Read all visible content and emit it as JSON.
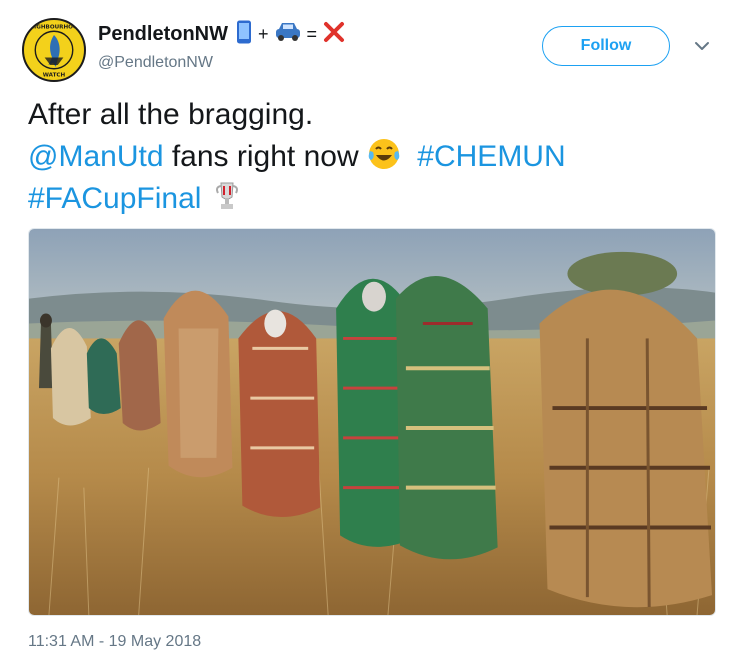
{
  "tweet": {
    "display_name": "PendletonNW",
    "handle": "@PendletonNW",
    "avatar_text_top": "NEIGHBOURHOOD",
    "avatar_text_bottom": "WATCH",
    "name_emojis": [
      "mobile-phone-emoji",
      "plus",
      "car-emoji",
      "equals",
      "cross-mark-emoji"
    ],
    "follow_label": "Follow",
    "text_line1": "After all the bragging.",
    "mention": "@ManUtd",
    "text_line2_mid": " fans right now",
    "hashtag_1": "#CHEMUN",
    "hashtag_2": "#FACupFinal",
    "emoji_laughing": "face-with-tears-of-joy-emoji",
    "emoji_trophy": "trophy-emoji",
    "timestamp": "11:31 AM - 19 May 2018",
    "plus": "+",
    "equals": "="
  },
  "colors": {
    "link": "#1b95e0",
    "follow_border": "#1da1f2",
    "muted": "#657786",
    "text": "#14171a"
  }
}
